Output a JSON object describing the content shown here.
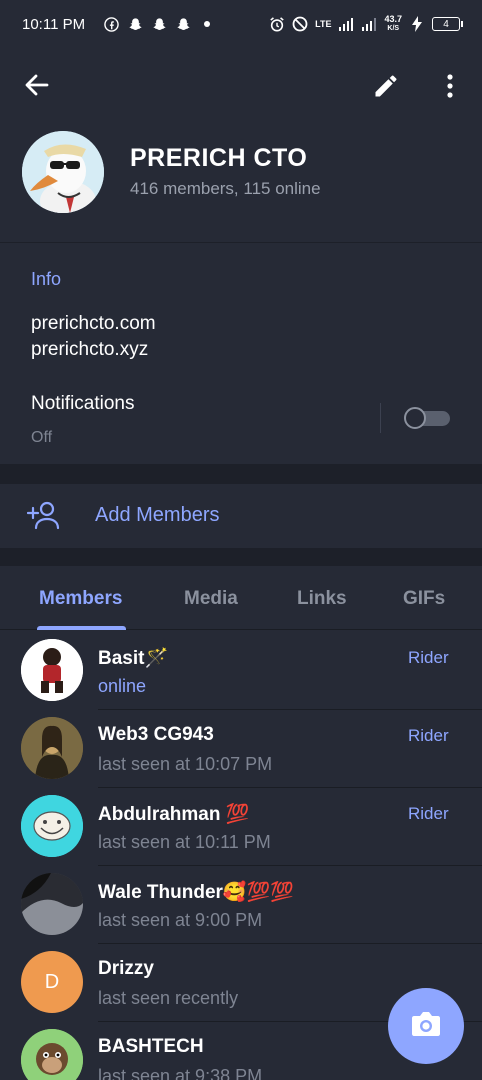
{
  "statusbar": {
    "time": "10:11 PM",
    "net_speed": "43.7",
    "net_unit": "K/S",
    "network_type": "LTE",
    "battery": "4"
  },
  "header": {
    "title": "PRERICH CTO",
    "subtitle": "416 members, 115 online"
  },
  "info": {
    "label": "Info",
    "text": "prerichcto.com\nprerichcto.xyz",
    "notifications_label": "Notifications",
    "notifications_state": "Off"
  },
  "add_members": {
    "label": "Add Members"
  },
  "tabs": [
    "Members",
    "Media",
    "Links",
    "GIFs"
  ],
  "members": [
    {
      "name": "Basit🪄",
      "status": "online",
      "role": "Rider",
      "avatar_color": "#ffffff",
      "initial": ""
    },
    {
      "name": "Web3 CG943",
      "status": "last seen at 10:07 PM",
      "role": "Rider",
      "avatar_color": "#6b5a3a",
      "initial": ""
    },
    {
      "name": "Abdulrahman 💯",
      "status": "last seen at 10:11 PM",
      "role": "Rider",
      "avatar_color": "#3fd6e0",
      "initial": ""
    },
    {
      "name": "Wale Thunder🥰💯💯",
      "status": "last seen at 9:00 PM",
      "role": "",
      "avatar_color": "#4a4d57",
      "initial": ""
    },
    {
      "name": "Drizzy",
      "status": "last seen recently",
      "role": "",
      "avatar_color": "#ef9a4f",
      "initial": "D"
    },
    {
      "name": "BASHTECH",
      "status": "last seen at 9:38 PM",
      "role": "",
      "avatar_color": "#7dbf6a",
      "initial": ""
    }
  ],
  "colors": {
    "accent": "#8ea6ff",
    "background": "#1d2029",
    "card": "#262a36",
    "muted_text": "#7e8492"
  }
}
